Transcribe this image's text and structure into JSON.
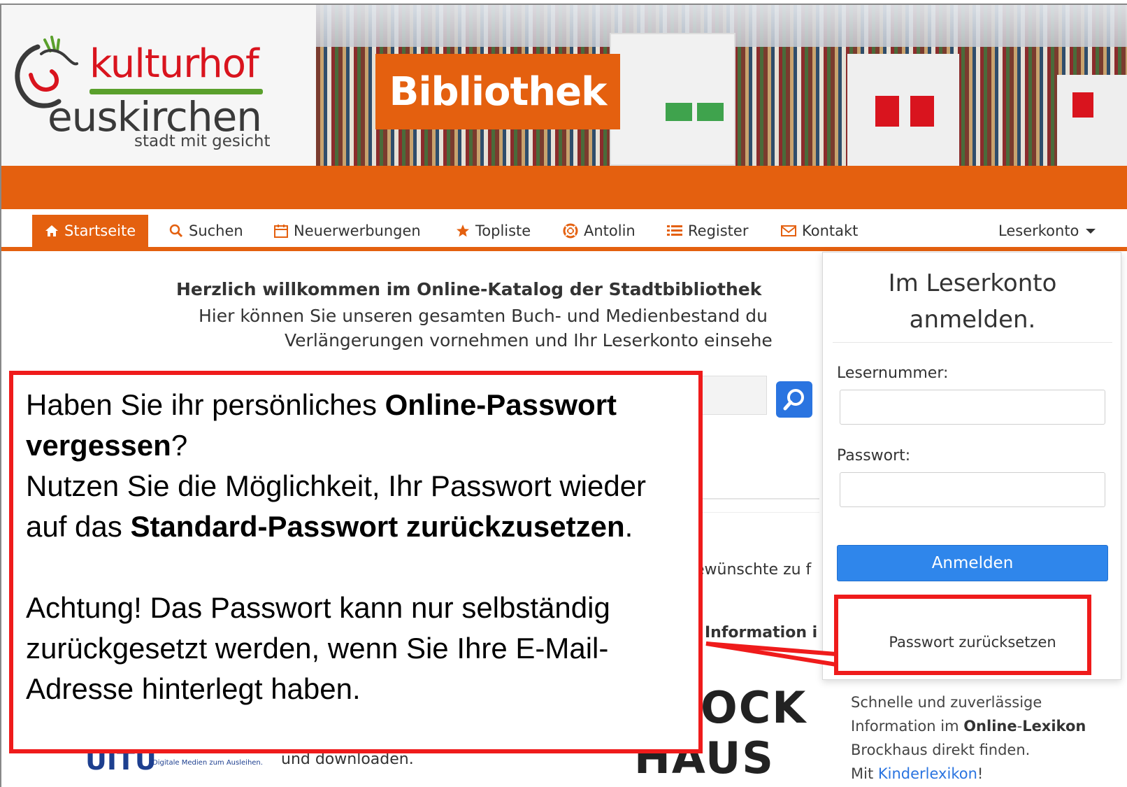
{
  "header": {
    "logo": {
      "kulturhof": "kulturhof",
      "euskirchen": "euskirchen",
      "tagline": "stadt mit gesicht"
    },
    "banner_title": "Bibliothek"
  },
  "nav": {
    "items": [
      {
        "label": "Startseite",
        "icon": "home-icon",
        "active": true
      },
      {
        "label": "Suchen",
        "icon": "search-icon"
      },
      {
        "label": "Neuerwerbungen",
        "icon": "calendar-icon"
      },
      {
        "label": "Topliste",
        "icon": "star-icon"
      },
      {
        "label": "Antolin",
        "icon": "life-ring-icon"
      },
      {
        "label": "Register",
        "icon": "list-icon"
      },
      {
        "label": "Kontakt",
        "icon": "envelope-icon"
      }
    ],
    "account_label": "Leserkonto"
  },
  "welcome": {
    "line1": "Herzlich willkommen im Online-Katalog der Stadtbibliothek",
    "line2": "Hier können Sie unseren gesamten Buch- und Medienbestand du",
    "line3": "Verlängerungen vornehmen und Ihr Leserkonto einsehe"
  },
  "content": {
    "gewuenschte": "ewünschte zu f",
    "information": "Information i",
    "brockhaus_line1": "OCK",
    "brockhaus_line2": "HAUS",
    "onleihe_logo": "UITU",
    "onleihe_sub": "Digitale Medien zum Ausleihen.",
    "onleihe_text": "und downloaden.",
    "brockhaus_desc": {
      "line1": "Schnelle und zuverlässige",
      "line2_pre": "Information im ",
      "line2_bold1": "Online",
      "line2_dash": "-",
      "line2_bold2": "Lexikon",
      "line3": "Brockhaus direkt finden.",
      "line4_pre": "Mit ",
      "line4_link": "Kinderlexikon",
      "line4_post": "!"
    }
  },
  "login": {
    "title_line1": "Im Leserkonto",
    "title_line2": "anmelden.",
    "lesernummer_label": "Lesernummer:",
    "lesernummer_value": "",
    "passwort_label": "Passwort:",
    "passwort_value": "",
    "submit_label": "Anmelden",
    "reset_label": "Passwort zurücksetzen"
  },
  "callout": {
    "p1_a": "Haben Sie ihr persönliches ",
    "p1_b": "Online-Passwort vergessen",
    "p1_c": "?",
    "p2_a": "Nutzen Sie die Möglichkeit, Ihr Passwort wieder auf das ",
    "p2_b": "Standard-Passwort zurückzusetzen",
    "p2_c": ".",
    "p3": "Achtung! Das Passwort kann nur selbständig zurückgesetzt werden, wenn Sie Ihre E-Mail-Adresse hinterlegt haben."
  },
  "colors": {
    "brand_orange": "#e4600f",
    "brand_red": "#d9141e",
    "brand_green": "#5aa02c",
    "button_blue": "#2f86eb",
    "annotation_red": "#ef1b1b"
  }
}
